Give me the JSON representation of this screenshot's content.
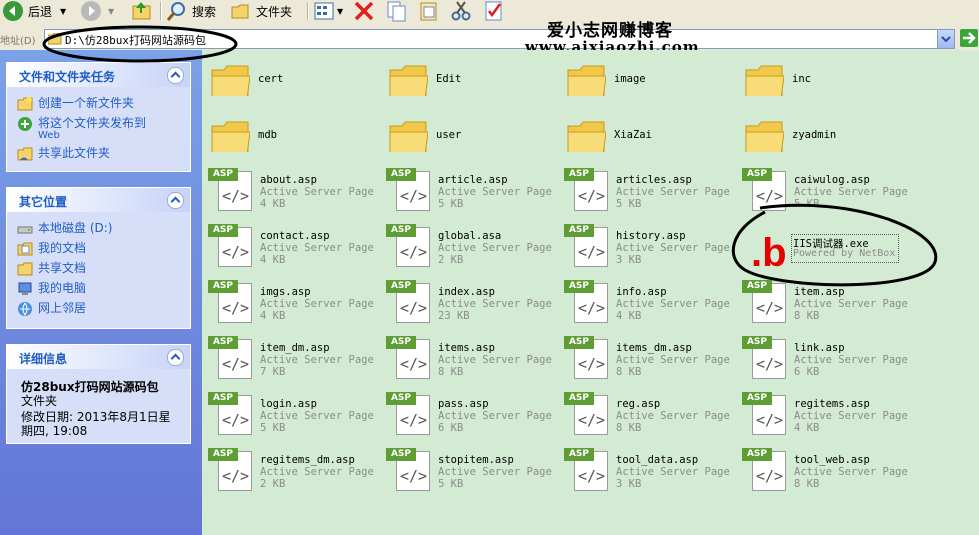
{
  "toolbar": {
    "back_label": "后退",
    "search_label": "搜索",
    "folders_label": "文件夹"
  },
  "address": {
    "label": "地址(D)",
    "path": "D:\\仿28bux打码网站源码包"
  },
  "watermark": {
    "line1": "爱小志网赚博客",
    "line2": "www.aixiaozhi.com"
  },
  "sidebar": {
    "tasks": {
      "title": "文件和文件夹任务",
      "items": [
        {
          "label": "创建一个新文件夹",
          "icon": "new-folder-icon"
        },
        {
          "label": "将这个文件夹发布到",
          "label2": "Web",
          "icon": "publish-web-icon"
        },
        {
          "label": "共享此文件夹",
          "icon": "share-folder-icon"
        }
      ]
    },
    "places": {
      "title": "其它位置",
      "items": [
        {
          "label": "本地磁盘 (D:)",
          "icon": "local-disk-icon"
        },
        {
          "label": "我的文档",
          "icon": "my-documents-icon"
        },
        {
          "label": "共享文档",
          "icon": "shared-documents-icon"
        },
        {
          "label": "我的电脑",
          "icon": "my-computer-icon"
        },
        {
          "label": "网上邻居",
          "icon": "network-places-icon"
        }
      ]
    },
    "details": {
      "title": "详细信息",
      "name": "仿28bux打码网站源码包",
      "type": "文件夹",
      "modified_line1": "修改日期: 2013年8月1日星",
      "modified_line2": "期四, 19:08"
    }
  },
  "folders": [
    "cert",
    "Edit",
    "image",
    "inc",
    "mdb",
    "user",
    "XiaZai",
    "zyadmin"
  ],
  "files": [
    {
      "name": "about.asp",
      "type": "Active Server Page",
      "size": "4 KB"
    },
    {
      "name": "article.asp",
      "type": "Active Server Page",
      "size": "5 KB"
    },
    {
      "name": "articles.asp",
      "type": "Active Server Page",
      "size": "5 KB"
    },
    {
      "name": "caiwulog.asp",
      "type": "Active Server Page",
      "size": "5 KB"
    },
    {
      "name": "contact.asp",
      "type": "Active Server Page",
      "size": "4 KB"
    },
    {
      "name": "global.asa",
      "type": "Active Server Page",
      "size": "2 KB"
    },
    {
      "name": "history.asp",
      "type": "Active Server Page",
      "size": "3 KB"
    },
    {
      "name": "IIS调试器.exe",
      "type": "Powered by NetBox",
      "size": "",
      "exe": true
    },
    {
      "name": "imgs.asp",
      "type": "Active Server Page",
      "size": "4 KB"
    },
    {
      "name": "index.asp",
      "type": "Active Server Page",
      "size": "23 KB"
    },
    {
      "name": "info.asp",
      "type": "Active Server Page",
      "size": "4 KB"
    },
    {
      "name": "item.asp",
      "type": "Active Server Page",
      "size": "8 KB"
    },
    {
      "name": "item_dm.asp",
      "type": "Active Server Page",
      "size": "7 KB"
    },
    {
      "name": "items.asp",
      "type": "Active Server Page",
      "size": "8 KB"
    },
    {
      "name": "items_dm.asp",
      "type": "Active Server Page",
      "size": "8 KB"
    },
    {
      "name": "link.asp",
      "type": "Active Server Page",
      "size": "6 KB"
    },
    {
      "name": "login.asp",
      "type": "Active Server Page",
      "size": "5 KB"
    },
    {
      "name": "pass.asp",
      "type": "Active Server Page",
      "size": "6 KB"
    },
    {
      "name": "reg.asp",
      "type": "Active Server Page",
      "size": "8 KB"
    },
    {
      "name": "regitems.asp",
      "type": "Active Server Page",
      "size": "4 KB"
    },
    {
      "name": "regitems_dm.asp",
      "type": "Active Server Page",
      "size": "2 KB"
    },
    {
      "name": "stopitem.asp",
      "type": "Active Server Page",
      "size": "5 KB"
    },
    {
      "name": "tool_data.asp",
      "type": "Active Server Page",
      "size": "3 KB"
    },
    {
      "name": "tool_web.asp",
      "type": "Active Server Page",
      "size": "8 KB"
    }
  ],
  "annotation": {
    "mark": ".b"
  },
  "icon_labels": {
    "asp": "ASP",
    "code": "</>"
  }
}
